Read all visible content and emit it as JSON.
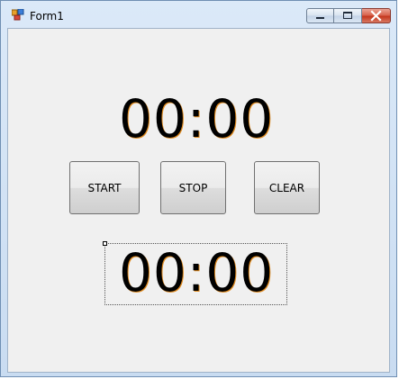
{
  "window": {
    "title": "Form1",
    "icon": "form-icon"
  },
  "caption_buttons": {
    "minimize_icon": "minimize-icon",
    "maximize_icon": "maximize-icon",
    "close_icon": "close-icon"
  },
  "timer_top": "00:00",
  "buttons": {
    "start": "START",
    "stop": "STOP",
    "clear": "CLEAR"
  },
  "timer_bottom": "00:00",
  "colors": {
    "digit_shadow": "#e08a1e",
    "close_button": "#c4381f"
  }
}
